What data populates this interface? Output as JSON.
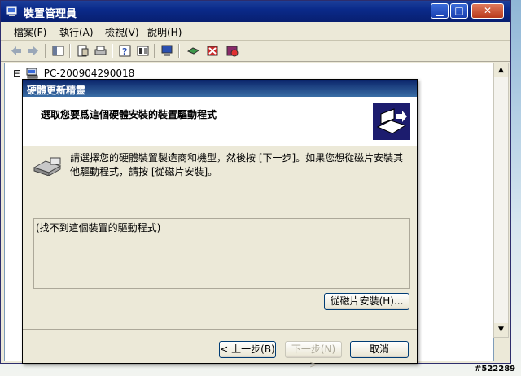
{
  "window": {
    "title": "裝置管理員",
    "icon": "computer-management-icon"
  },
  "menu": [
    "檔案(F)",
    "執行(A)",
    "檢視(V)",
    "說明(H)"
  ],
  "tree": {
    "root_label": "PC-200904290018",
    "expander": "⊟"
  },
  "dialog": {
    "title": "硬體更新精靈",
    "header_title": "選取您要爲這個硬體安裝的裝置驅動程式",
    "instruction": "請選擇您的硬體裝置製造商和機型，然後按 [下一步]。如果您想從磁片安裝其他驅動程式，請按 [從磁片安裝]。",
    "list_item": "(找不到這個裝置的驅動程式)",
    "have_disk_label": "從磁片安裝(H)...",
    "back_label": "< 上一步(B)",
    "next_label": "下一步(N) >",
    "cancel_label": "取消"
  },
  "watermark": "#522289",
  "colors": {
    "title_blue": "#0a246a",
    "window_face": "#ece9d8"
  }
}
